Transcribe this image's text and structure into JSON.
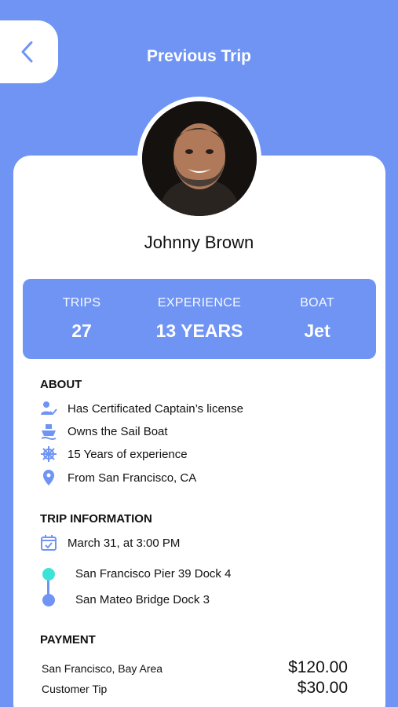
{
  "header": {
    "title": "Previous Trip"
  },
  "profile": {
    "name": "Johnny Brown"
  },
  "stats": [
    {
      "label": "TRIPS",
      "value": "27"
    },
    {
      "label": "EXPERIENCE",
      "value": "13 YEARS"
    },
    {
      "label": "BOAT",
      "value": "Jet"
    }
  ],
  "about": {
    "title": "ABOUT",
    "items": [
      {
        "icon": "user-check-icon",
        "text": "Has Certificated Captain’s license"
      },
      {
        "icon": "boat-icon",
        "text": "Owns the Sail Boat"
      },
      {
        "icon": "ship-wheel-icon",
        "text": "15 Years of experience"
      },
      {
        "icon": "location-pin-icon",
        "text": "From San Francisco, CA"
      }
    ]
  },
  "trip": {
    "title": "TRIP INFORMATION",
    "date": "March 31, at 3:00 PM",
    "from": "San Francisco Pier 39 Dock 4",
    "to": "San Mateo Bridge Dock 3"
  },
  "payment": {
    "title": "PAYMENT",
    "items": [
      {
        "label": "San Francisco, Bay Area",
        "amount": "$120.00"
      },
      {
        "label": "Customer Tip",
        "amount": "$30.00"
      }
    ]
  },
  "colors": {
    "accent": "#6f94f4",
    "route_start": "#3ee3d8",
    "card": "#ffffff"
  }
}
